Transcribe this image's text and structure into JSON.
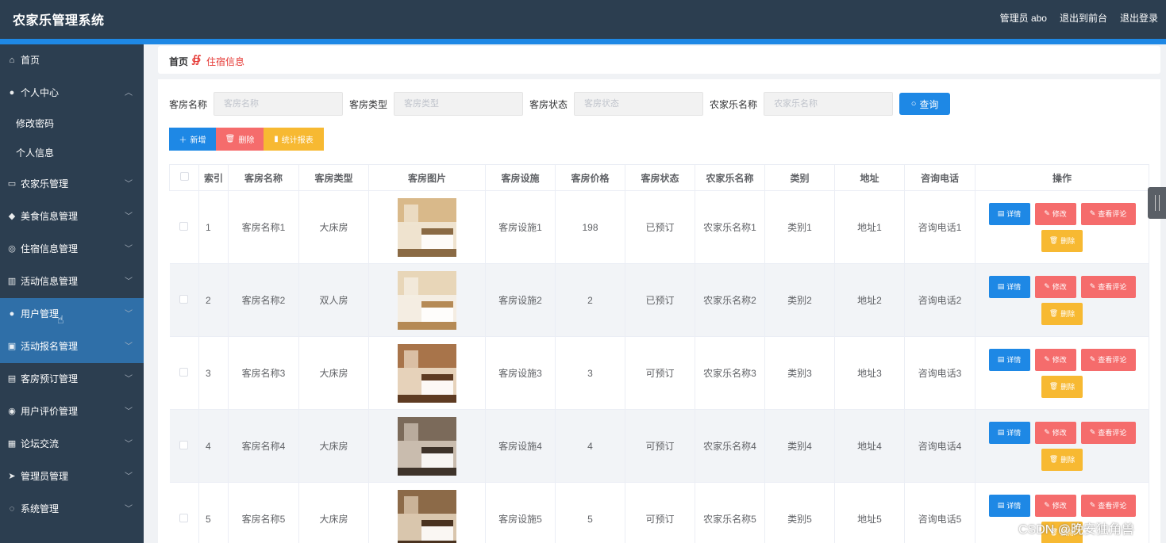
{
  "header": {
    "title": "农家乐管理系统",
    "admin": "管理员 abo",
    "front": "退出到前台",
    "logout": "退出登录"
  },
  "sidebar": {
    "items": [
      {
        "label": "首页",
        "icon": "home-icon",
        "chevron": false,
        "sub": false,
        "active": false
      },
      {
        "label": "个人中心",
        "icon": "user-icon",
        "chevron": true,
        "chevron_dir": "up",
        "sub": false,
        "active": false
      },
      {
        "label": "修改密码",
        "icon": "",
        "chevron": false,
        "sub": true,
        "active": false
      },
      {
        "label": "个人信息",
        "icon": "",
        "chevron": false,
        "sub": true,
        "active": false
      },
      {
        "label": "农家乐管理",
        "icon": "card-icon",
        "chevron": true,
        "sub": false,
        "active": false
      },
      {
        "label": "美食信息管理",
        "icon": "food-icon",
        "chevron": true,
        "sub": false,
        "active": false
      },
      {
        "label": "住宿信息管理",
        "icon": "compass-icon",
        "chevron": true,
        "sub": false,
        "active": false
      },
      {
        "label": "活动信息管理",
        "icon": "chart-icon",
        "chevron": true,
        "sub": false,
        "active": false
      },
      {
        "label": "用户管理",
        "icon": "user-icon",
        "chevron": true,
        "sub": false,
        "active": true
      },
      {
        "label": "活动报名管理",
        "icon": "check-icon",
        "chevron": true,
        "sub": false,
        "active": true
      },
      {
        "label": "客房预订管理",
        "icon": "chat-icon",
        "chevron": true,
        "sub": false,
        "active": false
      },
      {
        "label": "用户评价管理",
        "icon": "globe-icon",
        "chevron": true,
        "sub": false,
        "active": false
      },
      {
        "label": "论坛交流",
        "icon": "forum-icon",
        "chevron": true,
        "sub": false,
        "active": false
      },
      {
        "label": "管理员管理",
        "icon": "send-icon",
        "chevron": true,
        "sub": false,
        "active": false
      },
      {
        "label": "系统管理",
        "icon": "settings-icon",
        "chevron": true,
        "sub": false,
        "active": false
      }
    ]
  },
  "breadcrumb": {
    "home": "首页",
    "separator": "∯",
    "current": "住宿信息"
  },
  "search": {
    "name_label": "客房名称",
    "name_placeholder": "客房名称",
    "type_label": "客房类型",
    "type_placeholder": "客房类型",
    "status_label": "客房状态",
    "status_placeholder": "客房状态",
    "farm_label": "农家乐名称",
    "farm_placeholder": "农家乐名称",
    "query": "查询"
  },
  "actions": {
    "add": "新增",
    "delete": "删除",
    "report": "统计报表"
  },
  "table": {
    "headers": [
      "索引",
      "客房名称",
      "客房类型",
      "客房图片",
      "客房设施",
      "客房价格",
      "客房状态",
      "农家乐名称",
      "类别",
      "地址",
      "咨询电话",
      "操作"
    ],
    "rows": [
      {
        "index": "1",
        "name": "客房名称1",
        "type": "大床房",
        "facility": "客房设施1",
        "price": "198",
        "status": "已预订",
        "farm": "农家乐名称1",
        "category": "类别1",
        "address": "地址1",
        "phone": "咨询电话1",
        "img_tone": [
          "#d9b98a",
          "#8a6a44",
          "#efe3cf"
        ]
      },
      {
        "index": "2",
        "name": "客房名称2",
        "type": "双人房",
        "facility": "客房设施2",
        "price": "2",
        "status": "已预订",
        "farm": "农家乐名称2",
        "category": "类别2",
        "address": "地址2",
        "phone": "咨询电话2",
        "img_tone": [
          "#e8d6b8",
          "#b58a55",
          "#f4ede2"
        ]
      },
      {
        "index": "3",
        "name": "客房名称3",
        "type": "大床房",
        "facility": "客房设施3",
        "price": "3",
        "status": "可预订",
        "farm": "农家乐名称3",
        "category": "类别3",
        "address": "地址3",
        "phone": "咨询电话3",
        "img_tone": [
          "#a8744a",
          "#5e3b22",
          "#e6d2ba"
        ]
      },
      {
        "index": "4",
        "name": "客房名称4",
        "type": "大床房",
        "facility": "客房设施4",
        "price": "4",
        "status": "可预订",
        "farm": "农家乐名称4",
        "category": "类别4",
        "address": "地址4",
        "phone": "咨询电话4",
        "img_tone": [
          "#7b6a5a",
          "#3e332a",
          "#c9bcae"
        ]
      },
      {
        "index": "5",
        "name": "客房名称5",
        "type": "大床房",
        "facility": "客房设施5",
        "price": "5",
        "status": "可预订",
        "farm": "农家乐名称5",
        "category": "类别5",
        "address": "地址5",
        "phone": "咨询电话5",
        "img_tone": [
          "#8c6a48",
          "#4a3320",
          "#d9c6ad"
        ]
      }
    ],
    "ops": {
      "detail": "详情",
      "edit": "修改",
      "review": "查看评论",
      "delete": "删除"
    }
  },
  "watermark": "CSDN @晚安独角兽",
  "colors": {
    "primary": "#1e88e5",
    "danger": "#f56c6c",
    "warning": "#f7b932",
    "sidebar": "#2c3e50"
  }
}
